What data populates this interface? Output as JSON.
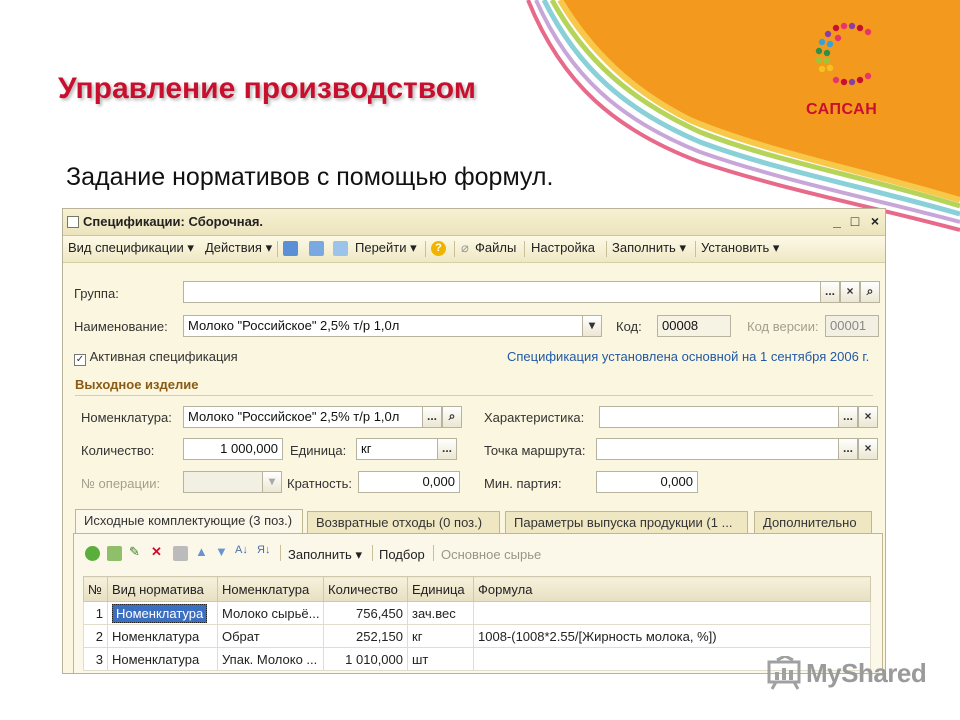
{
  "slide": {
    "title": "Управление производством",
    "subtitle": "Задание нормативов с помощью формул.",
    "logo_text": "САПСАН",
    "watermark": "MyShared"
  },
  "window": {
    "title": "Спецификации: Сборочная.",
    "controls": [
      "_",
      "□",
      "×"
    ],
    "toolbar": {
      "view": "Вид спецификации",
      "actions": "Действия",
      "goto": "Перейти",
      "files": "Файлы",
      "settings": "Настройка",
      "fill": "Заполнить",
      "set": "Установить"
    }
  },
  "form": {
    "group_label": "Группа:",
    "group_value": "",
    "name_label": "Наименование:",
    "name_value": "Молоко \"Российское\" 2,5% т/р 1,0л",
    "code_label": "Код:",
    "code_value": "00008",
    "version_label": "Код версии:",
    "version_value": "00001",
    "active_label": "Активная спецификация",
    "active_checked": true,
    "status_note": "Спецификация установлена основной на 1 сентября 2006 г.",
    "section_title": "Выходное изделие",
    "nomen_label": "Номенклатура:",
    "nomen_value": "Молоко \"Российское\" 2,5% т/р 1,0л",
    "char_label": "Характеристика:",
    "char_value": "",
    "qty_label": "Количество:",
    "qty_value": "1 000,000",
    "unit_label": "Единица:",
    "unit_value": "кг",
    "route_label": "Точка маршрута:",
    "route_value": "",
    "op_label": "№ операции:",
    "op_value": "",
    "mult_label": "Кратность:",
    "mult_value": "0,000",
    "minbatch_label": "Мин. партия:",
    "minbatch_value": "0,000"
  },
  "tabs": [
    {
      "label": "Исходные комплектующие (3 поз.)",
      "active": true
    },
    {
      "label": "Возвратные отходы (0 поз.)",
      "active": false
    },
    {
      "label": "Параметры выпуска продукции (1 ...",
      "active": false
    },
    {
      "label": "Дополнительно",
      "active": false
    }
  ],
  "table_toolbar": {
    "fill": "Заполнить",
    "select": "Подбор",
    "main_raw": "Основное сырье"
  },
  "table": {
    "columns": [
      "№",
      "Вид норматива",
      "Номенклатура",
      "Количество",
      "Единица",
      "Формула"
    ],
    "rows": [
      [
        "1",
        "Номенклатура",
        "Молоко сырьё...",
        "756,450",
        "зач.вес",
        ""
      ],
      [
        "2",
        "Номенклатура",
        "Обрат",
        "252,150",
        "кг",
        "1008-(1008*2.55/[Жирность молока, %])"
      ],
      [
        "3",
        "Номенклатура",
        "Упак. Молоко ...",
        "1 010,000",
        "шт",
        ""
      ]
    ]
  },
  "colors": {
    "title_red": "#c8102e",
    "banner_orange": "#f39a1e",
    "window_bg": "#fbf6df",
    "selection_blue": "#3d6fc1",
    "note_blue": "#2159a6"
  }
}
